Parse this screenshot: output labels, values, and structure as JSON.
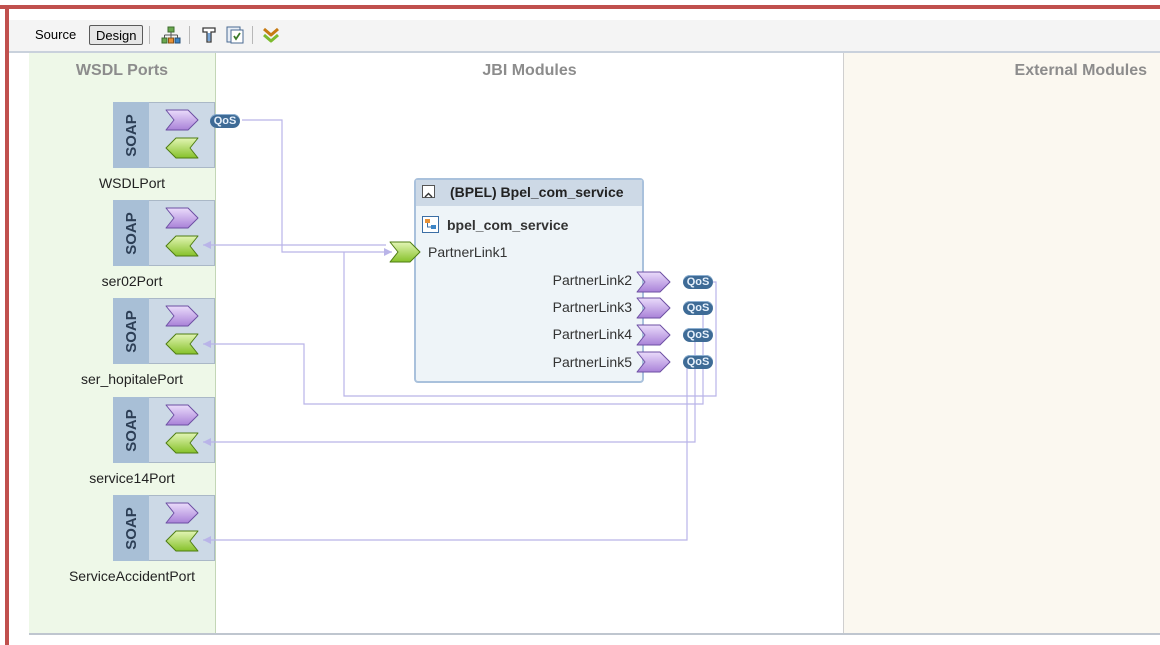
{
  "toolbar": {
    "source_label": "Source",
    "design_label": "Design",
    "icons": [
      "deploy-icon",
      "build-icon",
      "test-icon",
      "expand-icon"
    ]
  },
  "columns": {
    "wsdl_ports": "WSDL Ports",
    "jbi_modules": "JBI Modules",
    "external_modules": "External Modules"
  },
  "soap_label": "SOAP",
  "ports": [
    {
      "name": "WSDLPort"
    },
    {
      "name": "ser02Port"
    },
    {
      "name": "ser_hopitalePort"
    },
    {
      "name": "service14Port"
    },
    {
      "name": "ServiceAccidentPort"
    }
  ],
  "bpel_module": {
    "title": "(BPEL) Bpel_com_service",
    "subtitle": "bpel_com_service",
    "partner_links": [
      "PartnerLink1",
      "PartnerLink2",
      "PartnerLink3",
      "PartnerLink4",
      "PartnerLink5"
    ]
  },
  "qos_label": "QoS",
  "colors": {
    "frame": "#c0504d",
    "consumer_arrow": "#c4a8e8",
    "provider_arrow": "#9bd13a",
    "connection_line": "#b9b4e8"
  }
}
